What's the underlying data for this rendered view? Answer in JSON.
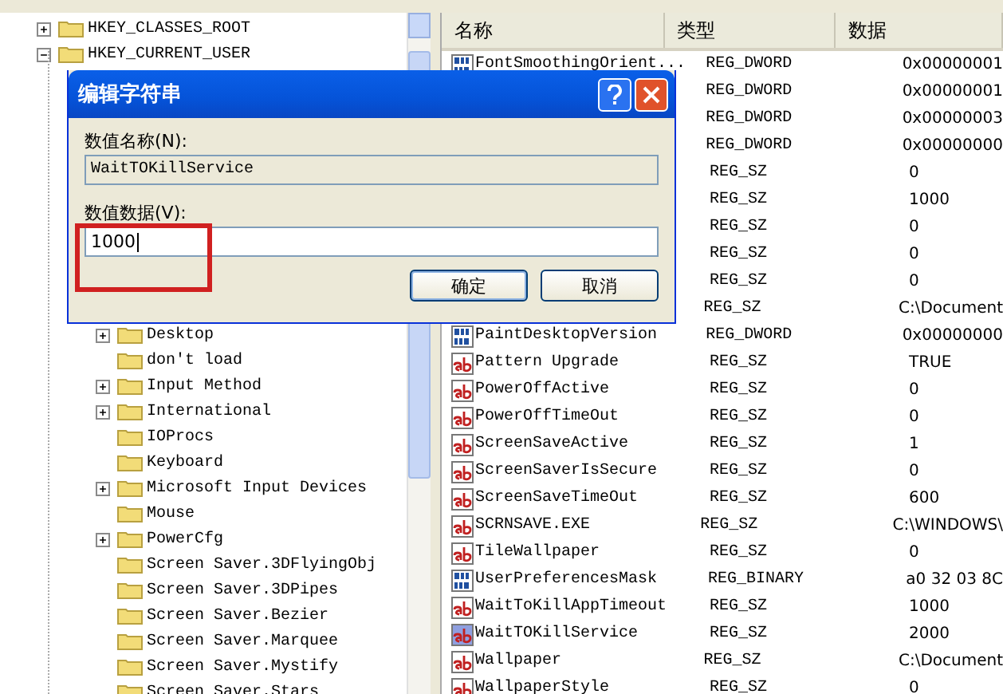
{
  "tree": [
    {
      "label": "HKEY_CLASSES_ROOT",
      "expanded": false
    },
    {
      "label": "HKEY_CURRENT_USER",
      "expanded": true,
      "children": [
        {
          "label": "Desktop",
          "expanded": false
        },
        {
          "label": "don't load"
        },
        {
          "label": "Input Method",
          "expanded": false
        },
        {
          "label": "International",
          "expanded": false
        },
        {
          "label": "IOProcs"
        },
        {
          "label": "Keyboard"
        },
        {
          "label": "Microsoft Input Devices",
          "expanded": false
        },
        {
          "label": "Mouse"
        },
        {
          "label": "PowerCfg",
          "expanded": false
        },
        {
          "label": "Screen Saver.3DFlyingObj"
        },
        {
          "label": "Screen Saver.3DPipes"
        },
        {
          "label": "Screen Saver.Bezier"
        },
        {
          "label": "Screen Saver.Marquee"
        },
        {
          "label": "Screen Saver.Mystify"
        },
        {
          "label": "Screen Saver.Stars"
        }
      ]
    }
  ],
  "list": {
    "columns": [
      "名称",
      "类型",
      "数据"
    ],
    "rows": [
      {
        "kind": "binary",
        "name": "FontSmoothingOrient...",
        "type": "REG_DWORD",
        "data": "0x00000001",
        "selected": false
      },
      {
        "type": "REG_DWORD",
        "data": "0x00000001",
        "selected": false
      },
      {
        "type": "REG_DWORD",
        "data": "0x00000003",
        "selected": false
      },
      {
        "type": "REG_DWORD",
        "data": "0x00000000",
        "selected": false
      },
      {
        "type": "REG_SZ",
        "data": "0",
        "selected": false
      },
      {
        "type": "REG_SZ",
        "data": "1000",
        "selected": false
      },
      {
        "type": "REG_SZ",
        "data": "0",
        "selected": false
      },
      {
        "type": "REG_SZ",
        "data": "0",
        "selected": false
      },
      {
        "type": "REG_SZ",
        "data": "0",
        "selected": false
      },
      {
        "type": "REG_SZ",
        "data": "C:\\Document",
        "selected": false
      },
      {
        "kind": "binary",
        "name": "PaintDesktopVersion",
        "type": "REG_DWORD",
        "data": "0x00000000",
        "selected": false
      },
      {
        "kind": "string",
        "name": "Pattern Upgrade",
        "type": "REG_SZ",
        "data": "TRUE",
        "selected": false
      },
      {
        "kind": "string",
        "name": "PowerOffActive",
        "type": "REG_SZ",
        "data": "0",
        "selected": false
      },
      {
        "kind": "string",
        "name": "PowerOffTimeOut",
        "type": "REG_SZ",
        "data": "0",
        "selected": false
      },
      {
        "kind": "string",
        "name": "ScreenSaveActive",
        "type": "REG_SZ",
        "data": "1",
        "selected": false
      },
      {
        "kind": "string",
        "name": "ScreenSaverIsSecure",
        "type": "REG_SZ",
        "data": "0",
        "selected": false
      },
      {
        "kind": "string",
        "name": "ScreenSaveTimeOut",
        "type": "REG_SZ",
        "data": "600",
        "selected": false
      },
      {
        "kind": "string",
        "name": "SCRNSAVE.EXE",
        "type": "REG_SZ",
        "data": "C:\\WINDOWS\\",
        "selected": false
      },
      {
        "kind": "string",
        "name": "TileWallpaper",
        "type": "REG_SZ",
        "data": "0",
        "selected": false
      },
      {
        "kind": "binary",
        "name": "UserPreferencesMask",
        "type": "REG_BINARY",
        "data": "a0 32 03 8C",
        "selected": false
      },
      {
        "kind": "string",
        "name": "WaitToKillAppTimeout",
        "type": "REG_SZ",
        "data": "1000",
        "selected": false
      },
      {
        "kind": "string",
        "name": "WaitTOKillService",
        "type": "REG_SZ",
        "data": "2000",
        "selected": true
      },
      {
        "kind": "string",
        "name": "Wallpaper",
        "type": "REG_SZ",
        "data": "C:\\Document",
        "selected": false
      },
      {
        "kind": "string",
        "name": "WallpaperStyle",
        "type": "REG_SZ",
        "data": "0",
        "selected": false
      }
    ]
  },
  "dialog": {
    "title": "编辑字符串",
    "name_label": "数值名称(N):",
    "name_value": "WaitTOKillService",
    "data_label": "数值数据(V):",
    "data_value": "1000",
    "buttons": [
      "确定",
      "取消"
    ],
    "highlight": true
  }
}
